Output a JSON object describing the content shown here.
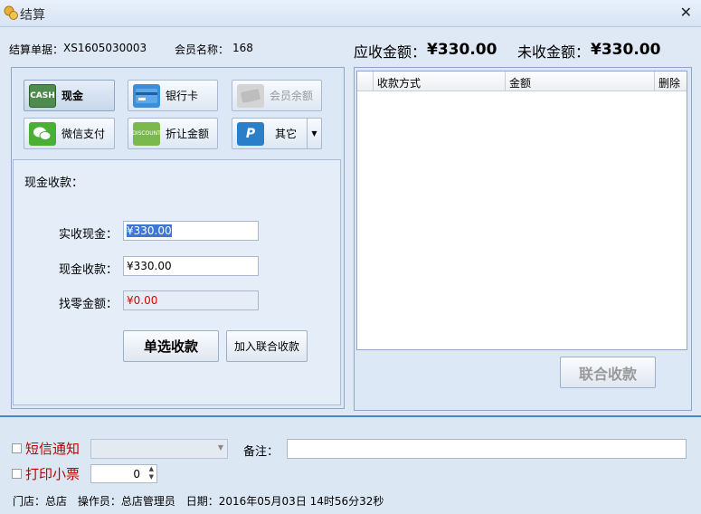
{
  "window": {
    "title": "结算",
    "close_glyph": "✕"
  },
  "header": {
    "order_label": "结算单据：",
    "order_no": "XS1605030003",
    "member_label": "会员名称：",
    "member_name": "168",
    "due_label": "应收金额：",
    "due_value": "¥330.00",
    "unpaid_label": "未收金额：",
    "unpaid_value": "¥330.00"
  },
  "payment_methods": [
    {
      "label": "现金",
      "icon": "cash-icon",
      "icon_text": "CASH",
      "color": "#4f8a4f"
    },
    {
      "label": "银行卡",
      "icon": "bank-card-icon",
      "icon_text": "",
      "color": "#3a8fd8"
    },
    {
      "label": "会员余额",
      "icon": "member-balance-icon",
      "icon_text": "",
      "color": "#c9c9c9"
    },
    {
      "label": "微信支付",
      "icon": "wechat-icon",
      "icon_text": "",
      "color": "#4caf35"
    },
    {
      "label": "折让金额",
      "icon": "discount-icon",
      "icon_text": "DISCOUNT",
      "color": "#7bb84e"
    },
    {
      "label": "其它",
      "icon": "paypal-icon",
      "icon_text": "P",
      "color": "#2b7fc9"
    }
  ],
  "cash_form": {
    "title": "现金收款：",
    "received_label": "实收现金：",
    "received_value": "¥330.00",
    "cash_label": "现金收款：",
    "cash_value": "¥330.00",
    "change_label": "找零金额：",
    "change_value": "¥0.00",
    "single_button": "单选收款",
    "add_button": "加入联合收款"
  },
  "grid": {
    "columns": [
      "收款方式",
      "金额",
      "删除"
    ]
  },
  "combined_button": "联合收款",
  "footer": {
    "sms_label": "短信通知",
    "note_label": "备注：",
    "print_label": "打印小票",
    "print_count": "0",
    "store_label": "门店：",
    "store_value": "总店",
    "operator_label": "操作员：",
    "operator_value": "总店管理员",
    "date_label": "日期：",
    "date_value": "2016年05月03日 14时56分32秒"
  }
}
